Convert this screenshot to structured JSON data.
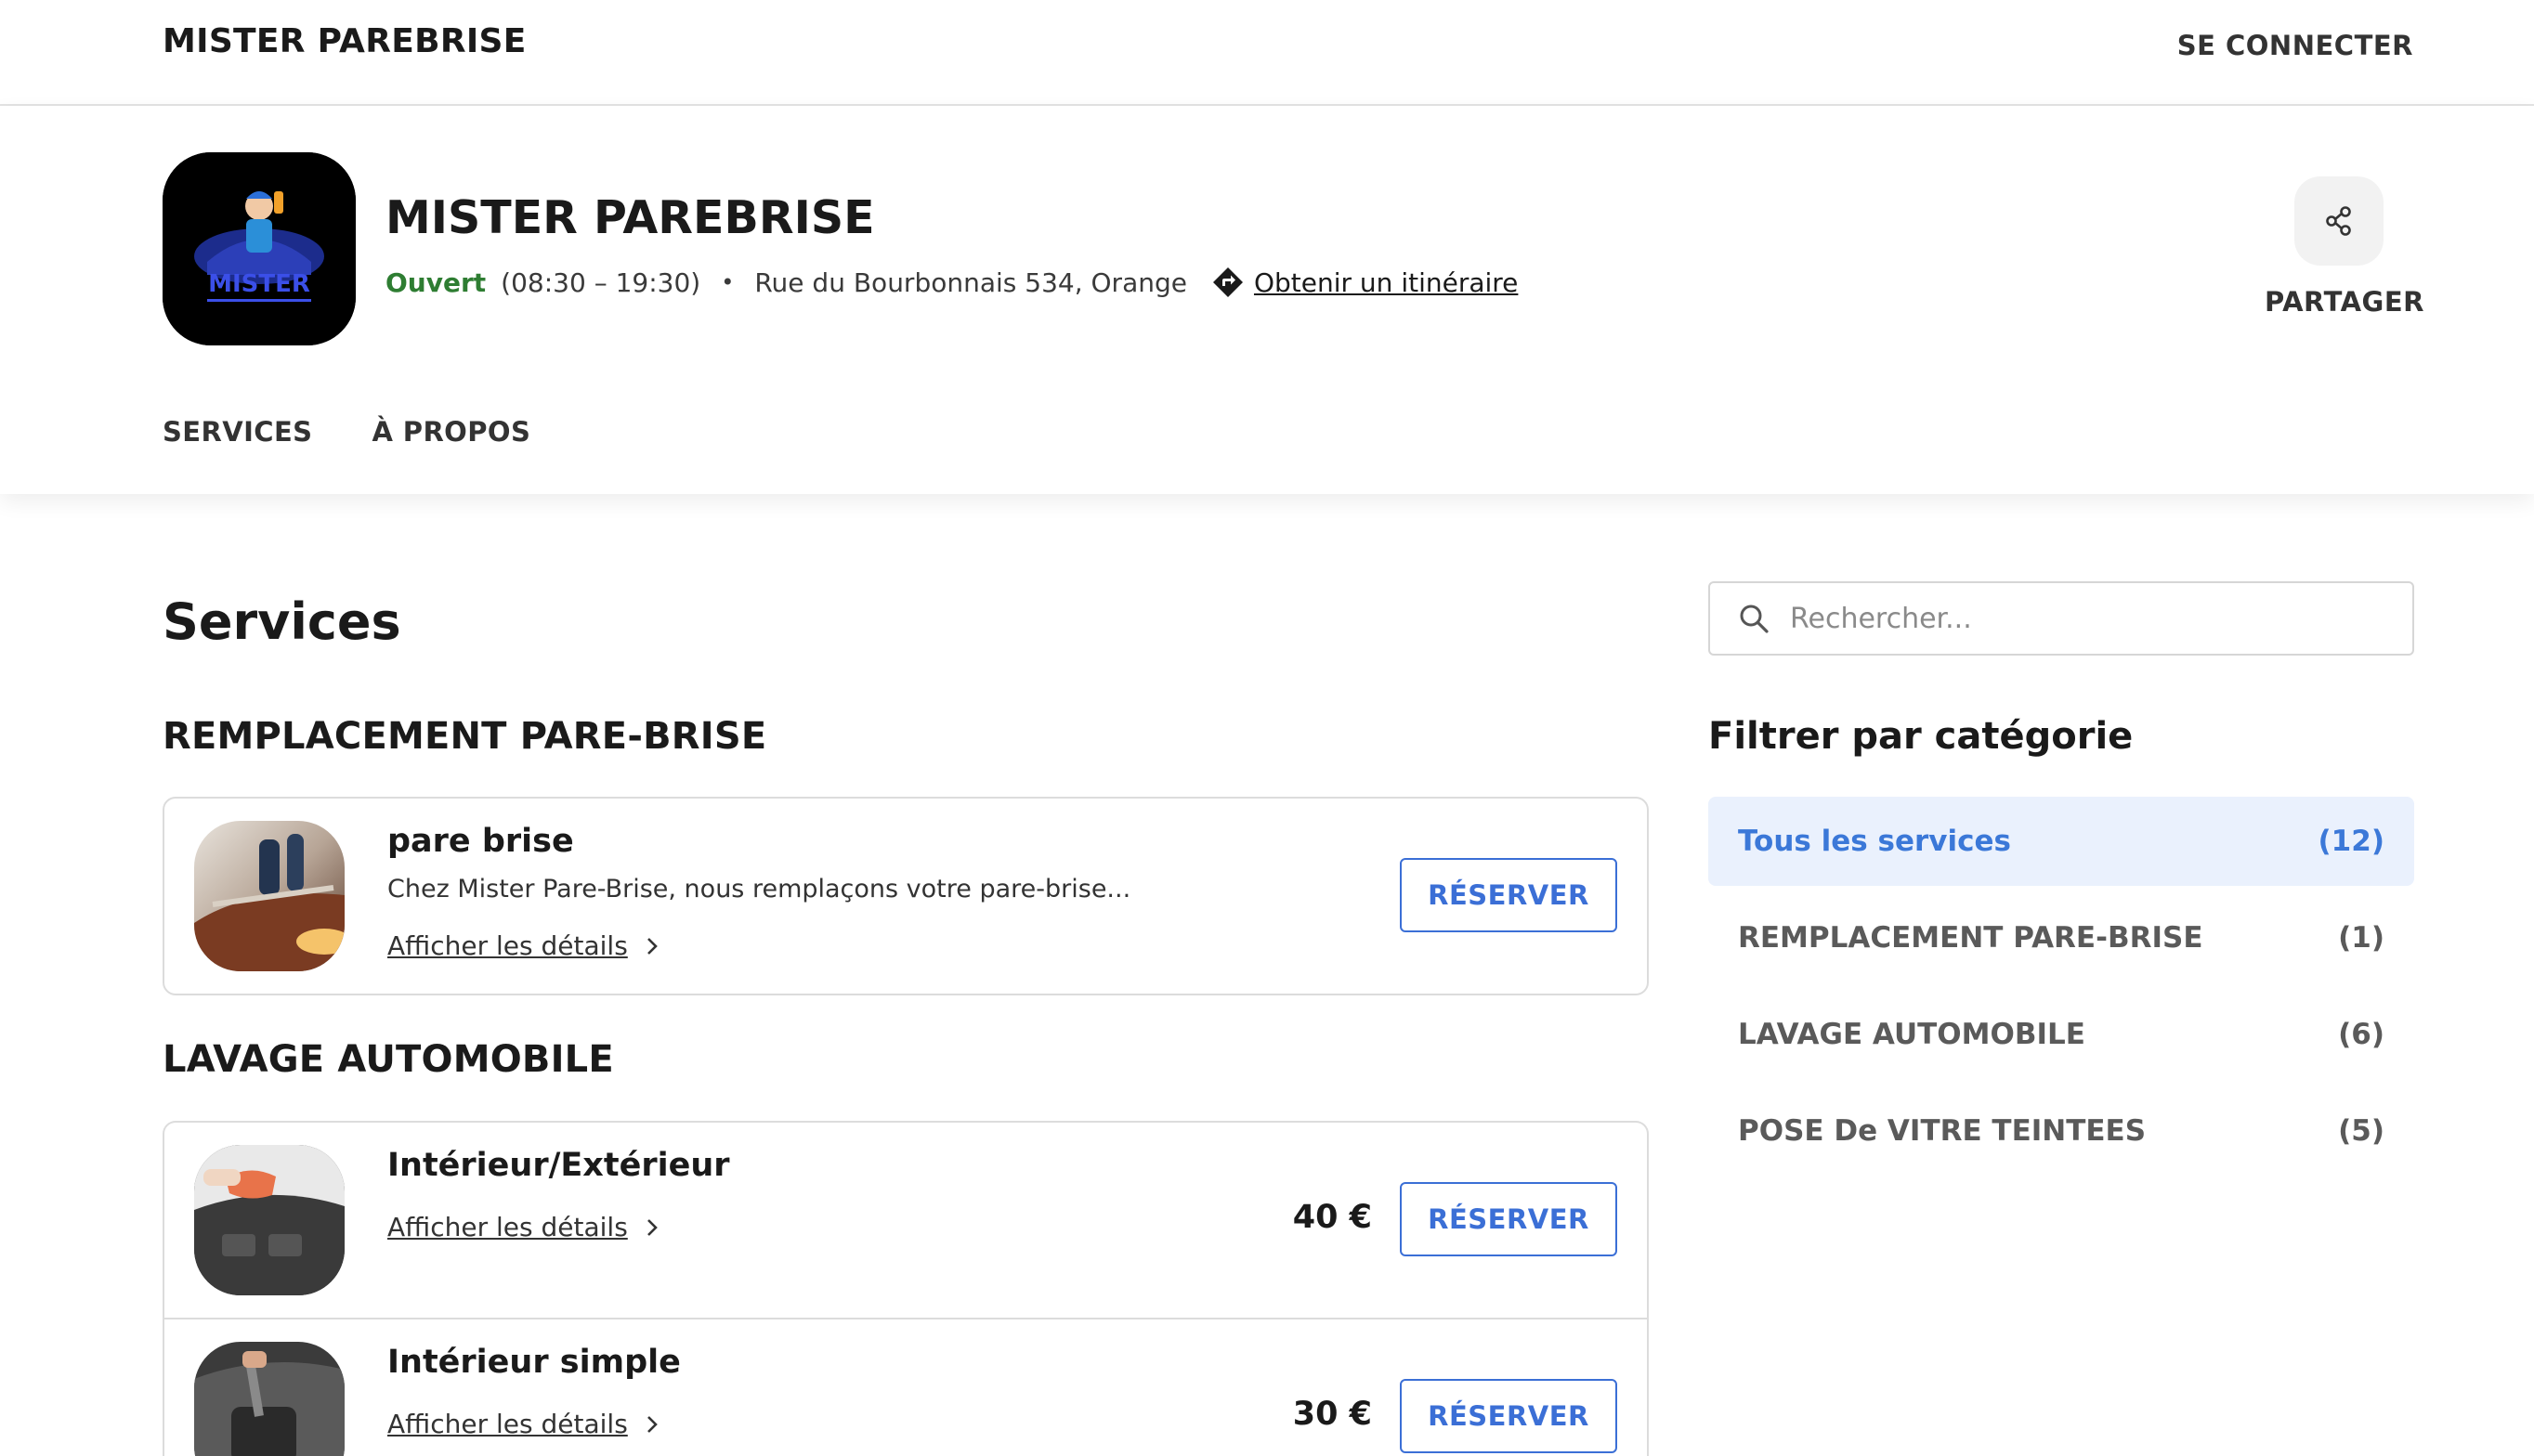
{
  "topbar": {
    "brand": "MISTER PAREBRISE",
    "login_label": "SE CONNECTER"
  },
  "business": {
    "name": "MISTER PAREBRISE",
    "logo_text": "MISTER",
    "status": "Ouvert",
    "hours": "(08:30 – 19:30)",
    "separator": "•",
    "address": "Rue du Bourbonnais 534, Orange",
    "directions_label": "Obtenir un itinéraire",
    "share_label": "PARTAGER"
  },
  "nav": {
    "items": [
      "SERVICES",
      "À PROPOS"
    ]
  },
  "services": {
    "title": "Services",
    "reserve_label": "RÉSERVER",
    "details_label": "Afficher les détails",
    "categories": [
      {
        "title": "REMPLACEMENT PARE-BRISE",
        "items": [
          {
            "name": "pare brise",
            "description": "Chez Mister Pare-Brise, nous remplaçons votre pare-brise...",
            "price": ""
          }
        ]
      },
      {
        "title": "LAVAGE AUTOMOBILE",
        "items": [
          {
            "name": "Intérieur/Extérieur",
            "description": "",
            "price": "40 €"
          },
          {
            "name": "Intérieur simple",
            "description": "",
            "price": "30 €"
          }
        ]
      }
    ]
  },
  "sidebar": {
    "search_placeholder": "Rechercher...",
    "filter_title": "Filtrer par catégorie",
    "filters": [
      {
        "label": "Tous les services",
        "count": "(12)",
        "active": true
      },
      {
        "label": "REMPLACEMENT PARE-BRISE",
        "count": "(1)",
        "active": false
      },
      {
        "label": "LAVAGE AUTOMOBILE",
        "count": "(6)",
        "active": false
      },
      {
        "label": "POSE De VITRE TEINTEES",
        "count": "(5)",
        "active": false
      }
    ]
  },
  "colors": {
    "accent": "#3b6fd6",
    "open_status": "#2e7d32",
    "active_filter_bg": "#eaf1fd"
  },
  "icons": {
    "share": "share-icon",
    "directions": "directions-icon",
    "search": "search-icon",
    "chevron": "chevron-right-icon"
  }
}
